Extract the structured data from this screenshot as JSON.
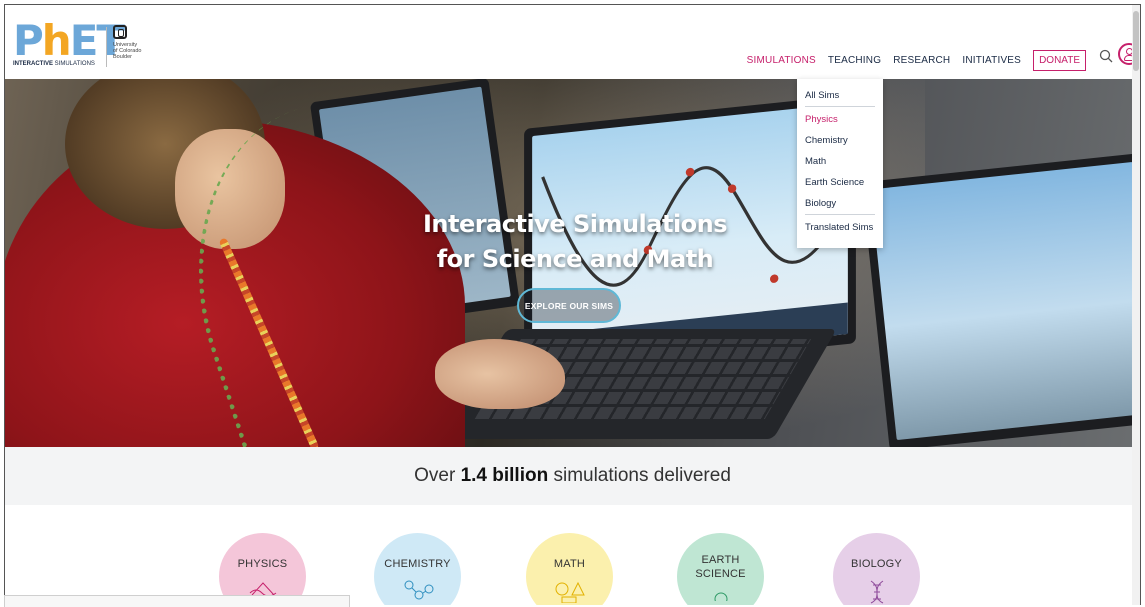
{
  "brand": {
    "logo_text": "PhET",
    "logo_subtitle_bold": "INTERACTIVE",
    "logo_subtitle_rest": " SIMULATIONS",
    "partner_lines": [
      "University",
      "of Colorado",
      "Boulder"
    ]
  },
  "nav": {
    "items": [
      "SIMULATIONS",
      "TEACHING",
      "RESEARCH",
      "INITIATIVES"
    ],
    "active_item": "SIMULATIONS",
    "donate_label": "DONATE",
    "search_icon": "search-icon",
    "account_icon": "user-icon"
  },
  "dropdown": {
    "items": [
      "All Sims",
      "Physics",
      "Chemistry",
      "Math",
      "Earth Science",
      "Biology",
      "Translated Sims"
    ],
    "active_item": "Physics"
  },
  "hero": {
    "title_line1": "Interactive Simulations",
    "title_line2": "for Science and Math",
    "cta_label": "EXPLORE OUR SIMS"
  },
  "stats": {
    "prefix": "Over ",
    "value": "1.4 billion",
    "suffix": " simulations delivered"
  },
  "categories": [
    {
      "label": "PHYSICS",
      "icon": "triangle-wave-icon",
      "color": "#f4c6d9"
    },
    {
      "label": "CHEMISTRY",
      "icon": "molecule-icon",
      "color": "#cfe9f6"
    },
    {
      "label": "MATH",
      "icon": "shapes-icon",
      "color": "#fbf0ad"
    },
    {
      "label": "EARTH SCIENCE",
      "label_line1": "EARTH",
      "label_line2": "SCIENCE",
      "icon": "globe-icon",
      "color": "#bfe6d3"
    },
    {
      "label": "BIOLOGY",
      "icon": "dna-icon",
      "color": "#e6cfe8"
    }
  ],
  "colors": {
    "accent": "#c6206b",
    "logo_blue": "#6ca7d8",
    "logo_orange": "#f3a623",
    "cta_border": "#5fb8d6"
  }
}
